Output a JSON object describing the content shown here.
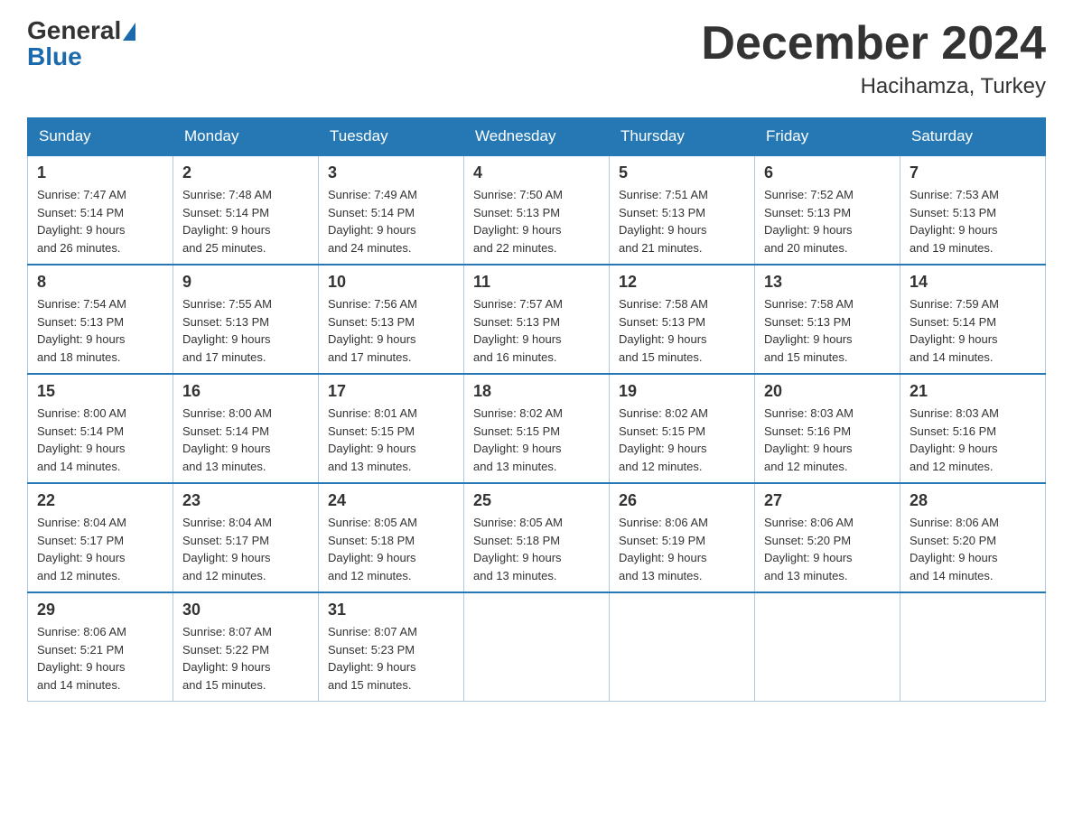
{
  "header": {
    "logo_general": "General",
    "logo_blue": "Blue",
    "month_title": "December 2024",
    "location": "Hacihamza, Turkey"
  },
  "weekdays": [
    "Sunday",
    "Monday",
    "Tuesday",
    "Wednesday",
    "Thursday",
    "Friday",
    "Saturday"
  ],
  "weeks": [
    [
      {
        "day": "1",
        "sunrise": "7:47 AM",
        "sunset": "5:14 PM",
        "daylight": "9 hours and 26 minutes."
      },
      {
        "day": "2",
        "sunrise": "7:48 AM",
        "sunset": "5:14 PM",
        "daylight": "9 hours and 25 minutes."
      },
      {
        "day": "3",
        "sunrise": "7:49 AM",
        "sunset": "5:14 PM",
        "daylight": "9 hours and 24 minutes."
      },
      {
        "day": "4",
        "sunrise": "7:50 AM",
        "sunset": "5:13 PM",
        "daylight": "9 hours and 22 minutes."
      },
      {
        "day": "5",
        "sunrise": "7:51 AM",
        "sunset": "5:13 PM",
        "daylight": "9 hours and 21 minutes."
      },
      {
        "day": "6",
        "sunrise": "7:52 AM",
        "sunset": "5:13 PM",
        "daylight": "9 hours and 20 minutes."
      },
      {
        "day": "7",
        "sunrise": "7:53 AM",
        "sunset": "5:13 PM",
        "daylight": "9 hours and 19 minutes."
      }
    ],
    [
      {
        "day": "8",
        "sunrise": "7:54 AM",
        "sunset": "5:13 PM",
        "daylight": "9 hours and 18 minutes."
      },
      {
        "day": "9",
        "sunrise": "7:55 AM",
        "sunset": "5:13 PM",
        "daylight": "9 hours and 17 minutes."
      },
      {
        "day": "10",
        "sunrise": "7:56 AM",
        "sunset": "5:13 PM",
        "daylight": "9 hours and 17 minutes."
      },
      {
        "day": "11",
        "sunrise": "7:57 AM",
        "sunset": "5:13 PM",
        "daylight": "9 hours and 16 minutes."
      },
      {
        "day": "12",
        "sunrise": "7:58 AM",
        "sunset": "5:13 PM",
        "daylight": "9 hours and 15 minutes."
      },
      {
        "day": "13",
        "sunrise": "7:58 AM",
        "sunset": "5:13 PM",
        "daylight": "9 hours and 15 minutes."
      },
      {
        "day": "14",
        "sunrise": "7:59 AM",
        "sunset": "5:14 PM",
        "daylight": "9 hours and 14 minutes."
      }
    ],
    [
      {
        "day": "15",
        "sunrise": "8:00 AM",
        "sunset": "5:14 PM",
        "daylight": "9 hours and 14 minutes."
      },
      {
        "day": "16",
        "sunrise": "8:00 AM",
        "sunset": "5:14 PM",
        "daylight": "9 hours and 13 minutes."
      },
      {
        "day": "17",
        "sunrise": "8:01 AM",
        "sunset": "5:15 PM",
        "daylight": "9 hours and 13 minutes."
      },
      {
        "day": "18",
        "sunrise": "8:02 AM",
        "sunset": "5:15 PM",
        "daylight": "9 hours and 13 minutes."
      },
      {
        "day": "19",
        "sunrise": "8:02 AM",
        "sunset": "5:15 PM",
        "daylight": "9 hours and 12 minutes."
      },
      {
        "day": "20",
        "sunrise": "8:03 AM",
        "sunset": "5:16 PM",
        "daylight": "9 hours and 12 minutes."
      },
      {
        "day": "21",
        "sunrise": "8:03 AM",
        "sunset": "5:16 PM",
        "daylight": "9 hours and 12 minutes."
      }
    ],
    [
      {
        "day": "22",
        "sunrise": "8:04 AM",
        "sunset": "5:17 PM",
        "daylight": "9 hours and 12 minutes."
      },
      {
        "day": "23",
        "sunrise": "8:04 AM",
        "sunset": "5:17 PM",
        "daylight": "9 hours and 12 minutes."
      },
      {
        "day": "24",
        "sunrise": "8:05 AM",
        "sunset": "5:18 PM",
        "daylight": "9 hours and 12 minutes."
      },
      {
        "day": "25",
        "sunrise": "8:05 AM",
        "sunset": "5:18 PM",
        "daylight": "9 hours and 13 minutes."
      },
      {
        "day": "26",
        "sunrise": "8:06 AM",
        "sunset": "5:19 PM",
        "daylight": "9 hours and 13 minutes."
      },
      {
        "day": "27",
        "sunrise": "8:06 AM",
        "sunset": "5:20 PM",
        "daylight": "9 hours and 13 minutes."
      },
      {
        "day": "28",
        "sunrise": "8:06 AM",
        "sunset": "5:20 PM",
        "daylight": "9 hours and 14 minutes."
      }
    ],
    [
      {
        "day": "29",
        "sunrise": "8:06 AM",
        "sunset": "5:21 PM",
        "daylight": "9 hours and 14 minutes."
      },
      {
        "day": "30",
        "sunrise": "8:07 AM",
        "sunset": "5:22 PM",
        "daylight": "9 hours and 15 minutes."
      },
      {
        "day": "31",
        "sunrise": "8:07 AM",
        "sunset": "5:23 PM",
        "daylight": "9 hours and 15 minutes."
      },
      null,
      null,
      null,
      null
    ]
  ],
  "labels": {
    "sunrise": "Sunrise:",
    "sunset": "Sunset:",
    "daylight": "Daylight:"
  }
}
